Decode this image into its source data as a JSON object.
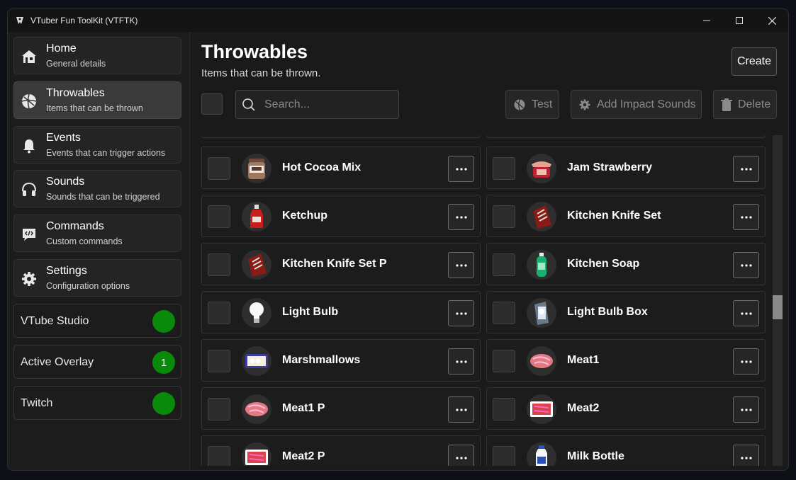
{
  "window": {
    "title": "VTuber Fun ToolKit (VTFTK)"
  },
  "sidebar": {
    "nav": [
      {
        "title": "Home",
        "subtitle": "General details",
        "icon": "house-icon"
      },
      {
        "title": "Throwables",
        "subtitle": "Items that can be thrown",
        "icon": "ball-icon"
      },
      {
        "title": "Events",
        "subtitle": "Events that can trigger actions",
        "icon": "bell-icon"
      },
      {
        "title": "Sounds",
        "subtitle": "Sounds that can be triggered",
        "icon": "headphones-icon"
      },
      {
        "title": "Commands",
        "subtitle": "Custom commands",
        "icon": "code-bubble-icon"
      },
      {
        "title": "Settings",
        "subtitle": "Configuration options",
        "icon": "gear-icon"
      }
    ],
    "status": [
      {
        "label": "VTube Studio",
        "badge": ""
      },
      {
        "label": "Active Overlay",
        "badge": "1"
      },
      {
        "label": "Twitch",
        "badge": ""
      }
    ]
  },
  "main": {
    "title": "Throwables",
    "subtitle": "Items that can be thrown.",
    "create_label": "Create",
    "search_placeholder": "Search...",
    "toolbar": {
      "test_label": "Test",
      "impact_label": "Add Impact Sounds",
      "delete_label": "Delete"
    }
  },
  "items": [
    {
      "name": "Hot Cocoa Mix",
      "icon": "cocoa-jar-icon"
    },
    {
      "name": "Jam Strawberry",
      "icon": "jam-jar-icon"
    },
    {
      "name": "Ketchup",
      "icon": "ketchup-bottle-icon"
    },
    {
      "name": "Kitchen Knife Set",
      "icon": "knife-block-icon"
    },
    {
      "name": "Kitchen Knife Set P",
      "icon": "knife-block-icon"
    },
    {
      "name": "Kitchen Soap",
      "icon": "soap-bottle-icon"
    },
    {
      "name": "Light Bulb",
      "icon": "light-bulb-icon"
    },
    {
      "name": "Light Bulb Box",
      "icon": "bulb-box-icon"
    },
    {
      "name": "Marshmallows",
      "icon": "marshmallow-bag-icon"
    },
    {
      "name": "Meat1",
      "icon": "meat-icon"
    },
    {
      "name": "Meat1 P",
      "icon": "meat-icon"
    },
    {
      "name": "Meat2",
      "icon": "meat-tray-icon"
    },
    {
      "name": "Meat2 P",
      "icon": "meat-tray-icon"
    },
    {
      "name": "Milk Bottle",
      "icon": "milk-bottle-icon"
    }
  ],
  "colors": {
    "status_green": "#0a8a0a",
    "accent": "#3a3a3a"
  }
}
